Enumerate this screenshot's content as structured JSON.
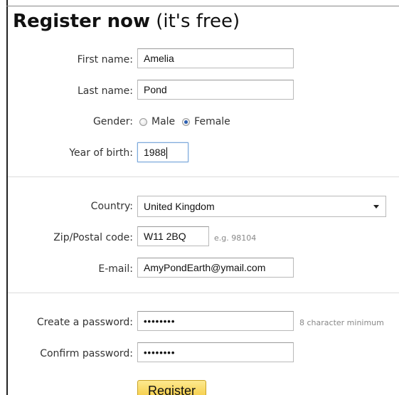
{
  "title": {
    "bold": "Register now",
    "light": "(it's free)"
  },
  "personal": {
    "first_name": {
      "label": "First name:",
      "value": "Amelia"
    },
    "last_name": {
      "label": "Last name:",
      "value": "Pond"
    },
    "gender": {
      "label": "Gender:",
      "options": [
        "Male",
        "Female"
      ],
      "selected": "Female"
    },
    "year_of_birth": {
      "label": "Year of birth:",
      "value": "1988"
    }
  },
  "location": {
    "country": {
      "label": "Country:",
      "value": "United Kingdom"
    },
    "zip": {
      "label": "Zip/Postal code:",
      "value": "W11 2BQ",
      "hint": "e.g. 98104"
    },
    "email": {
      "label": "E-mail:",
      "value": "AmyPondEarth@ymail.com"
    }
  },
  "security": {
    "password": {
      "label": "Create a password:",
      "masked": "••••••••",
      "hint": "8 character minimum"
    },
    "confirm_password": {
      "label": "Confirm password:",
      "masked": "••••••••"
    }
  },
  "submit_label": "Register",
  "colors": {
    "register_button_top": "#fde98f",
    "register_button_bottom": "#f4c83a",
    "radio_checked": "#2a5db0"
  }
}
